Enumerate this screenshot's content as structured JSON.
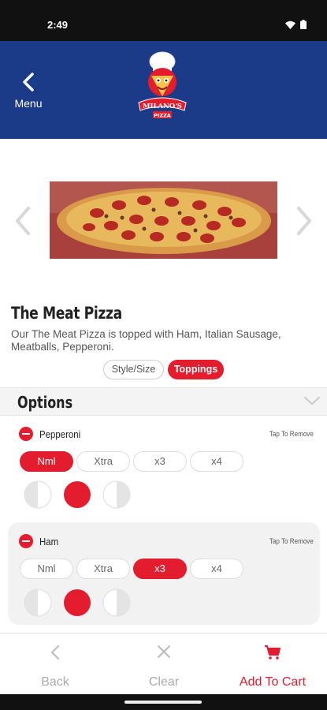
{
  "status": {
    "time": "2:49"
  },
  "header": {
    "back_label": "Menu",
    "logo_text": "MILANO'S",
    "logo_sub": "PIZZA"
  },
  "product": {
    "title": "The Meat Pizza",
    "description": "Our The Meat Pizza is topped with Ham, Italian Sausage, Meatballs, Pepperoni."
  },
  "tabs": {
    "style_size": "Style/Size",
    "toppings": "Toppings",
    "active": "Toppings"
  },
  "options": {
    "title": "Options"
  },
  "toppings": [
    {
      "name": "Pepperoni",
      "tap_label": "Tap To Remove",
      "amounts": [
        "Nml",
        "Xtra",
        "x3",
        "x4"
      ],
      "selected_amount": "Nml",
      "selected_side": "whole"
    },
    {
      "name": "Ham",
      "tap_label": "Tap To Remove",
      "amounts": [
        "Nml",
        "Xtra",
        "x3",
        "x4"
      ],
      "selected_amount": "x3",
      "selected_side": "whole"
    }
  ],
  "footer": {
    "back": "Back",
    "clear": "Clear",
    "add_to_cart": "Add To Cart"
  },
  "colors": {
    "brand_blue": "#1b3a87",
    "accent_red": "#e31d2e"
  }
}
